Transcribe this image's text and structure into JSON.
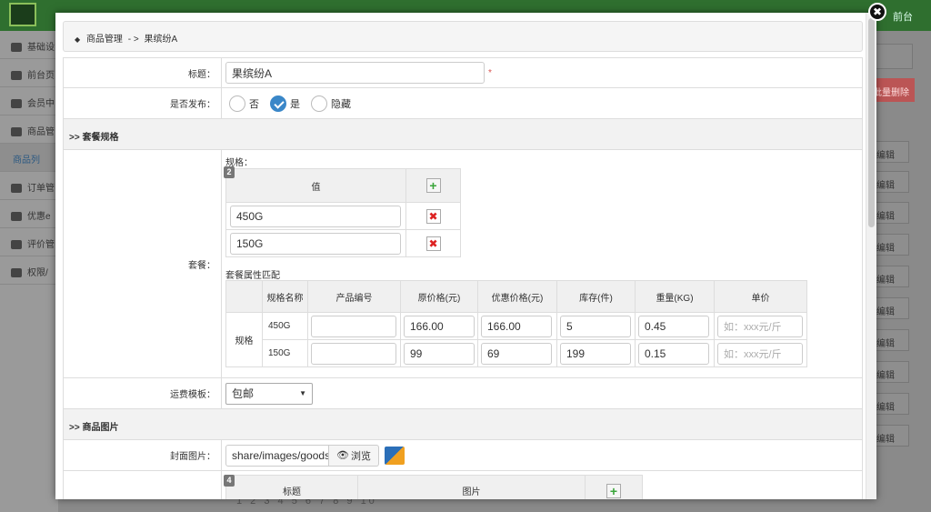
{
  "background": {
    "top_links": "前台",
    "sidebar": [
      "基础设",
      "前台页",
      "会员中",
      "商品管",
      "商品列",
      "订单管",
      "优惠e",
      "评价管",
      "权限/"
    ],
    "bulk_delete": "批量删除",
    "edit_label": "编辑",
    "pager": "1 2 3 4 5 6 7 8 9 10"
  },
  "modal": {
    "close_symbol": "✖",
    "breadcrumb": {
      "parent": "商品管理",
      "separator": "- >",
      "current": "果缤纷A"
    }
  },
  "form": {
    "title": {
      "label": "标题：",
      "value": "果缤纷A",
      "required": "*"
    },
    "publish": {
      "label": "是否发布：",
      "options": [
        "否",
        "是",
        "隐藏"
      ],
      "selected": "是"
    },
    "package_section": ">> 套餐规格",
    "package": {
      "label": "套餐：",
      "spec_label": "规格：",
      "spec_badge": "2",
      "spec_header": "值",
      "spec_values": [
        "450G",
        "150G"
      ],
      "attr_title": "套餐属性匹配",
      "attr_headers": [
        "规格名称",
        "产品编号",
        "原价格(元)",
        "优惠价格(元)",
        "库存(件)",
        "重量(KG)",
        "单价"
      ],
      "row_group_label": "规格",
      "rows": [
        {
          "name": "450G",
          "code": "",
          "price": "166.00",
          "discount": "166.00",
          "stock": "5",
          "weight": "0.45",
          "unit_placeholder": "如：xxx元/斤"
        },
        {
          "name": "150G",
          "code": "",
          "price": "99",
          "discount": "69",
          "stock": "199",
          "weight": "0.15",
          "unit_placeholder": "如：xxx元/斤"
        }
      ]
    },
    "shipping": {
      "label": "运费模板：",
      "value": "包邮"
    },
    "image_section": ">> 商品图片",
    "cover": {
      "label": "封面图片：",
      "value": "share/images/goods",
      "browse": "浏览",
      "browse_icon": "eye-icon"
    },
    "gallery": {
      "badge": "4",
      "headers": [
        "标题",
        "图片"
      ]
    }
  }
}
